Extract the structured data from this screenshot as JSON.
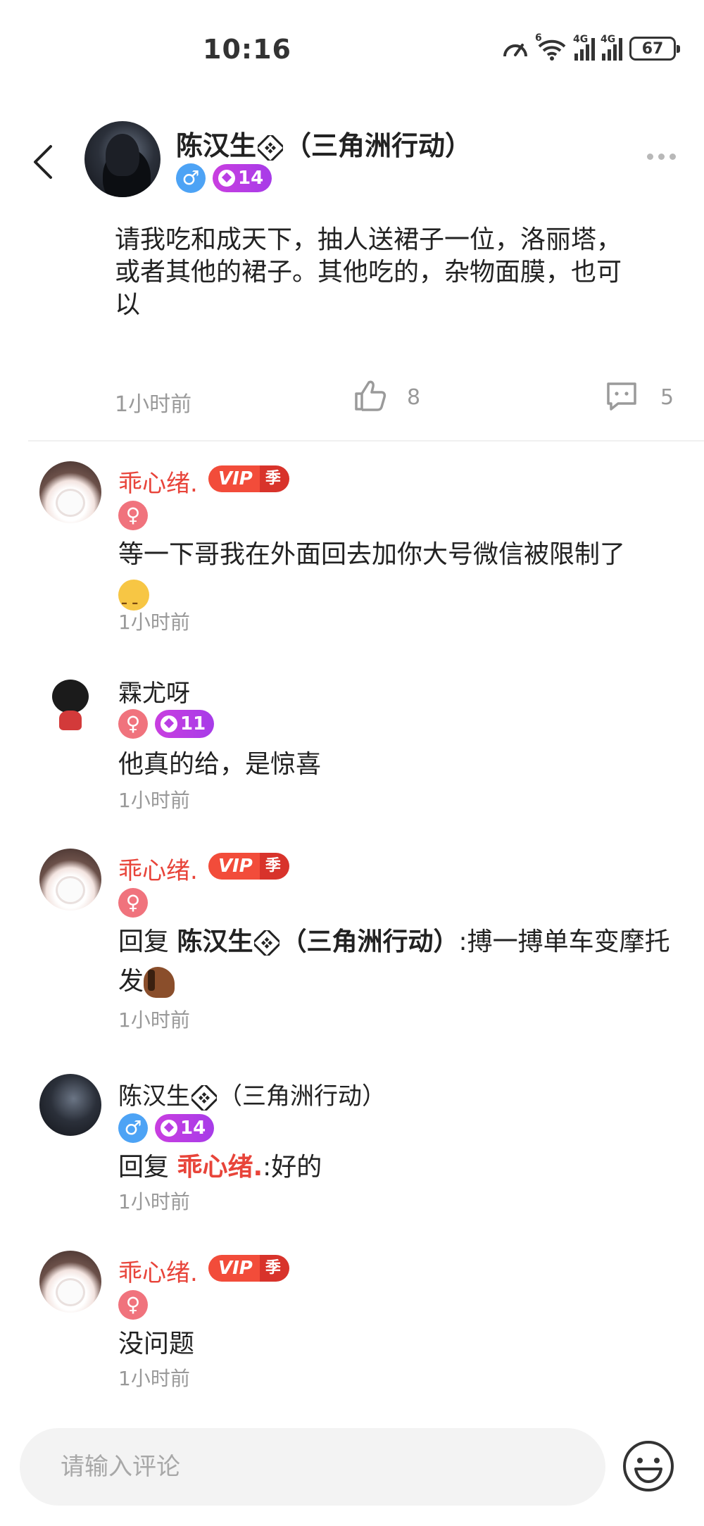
{
  "status_bar": {
    "time": "10:16",
    "battery": "67",
    "net1": "4G",
    "net2": "4G",
    "wifi_badge": "6"
  },
  "post": {
    "author": "陈汉生",
    "author_suffix": "（三角洲行动）",
    "gender": "♂",
    "level": "14",
    "body": "请我吃和成天下，抽人送裙子一位，洛丽塔，或者其他的裙子。其他吃的，杂物面膜，也可以",
    "time": "1小时前",
    "likes": "8",
    "comments": "5"
  },
  "comments": [
    {
      "name": "乖心绪.",
      "vip": "VIP",
      "vip_season": "季",
      "gender": "♀",
      "text": "等一下哥我在外面回去加你大号微信被限制了",
      "emoji": "sad-face-emoji",
      "time": "1小时前"
    },
    {
      "name": "霖尤呀",
      "gender": "♀",
      "level": "11",
      "text": "他真的给，是惊喜",
      "time": "1小时前"
    },
    {
      "name": "乖心绪.",
      "vip": "VIP",
      "vip_season": "季",
      "gender": "♀",
      "reply_prefix": "回复 ",
      "reply_to": "陈汉生",
      "reply_to_suffix": "（三角洲行动）",
      "text": ":搏一搏单车变摩托 发",
      "emoji": "horse-emoji",
      "time": "1小时前"
    },
    {
      "name": "陈汉生",
      "name_suffix": "（三角洲行动）",
      "gender": "♂",
      "level": "14",
      "reply_prefix": "回复 ",
      "reply_to": "乖心绪.",
      "text": ":好的",
      "time": "1小时前"
    },
    {
      "name": "乖心绪.",
      "vip": "VIP",
      "vip_season": "季",
      "gender": "♀",
      "text": "没问题",
      "time": "1小时前"
    }
  ],
  "input": {
    "placeholder": "请输入评论"
  },
  "colors": {
    "accent_red": "#e8443a",
    "male_blue": "#4da3f5",
    "female_pink": "#f0737d",
    "level_purple": "#b93ee4"
  }
}
